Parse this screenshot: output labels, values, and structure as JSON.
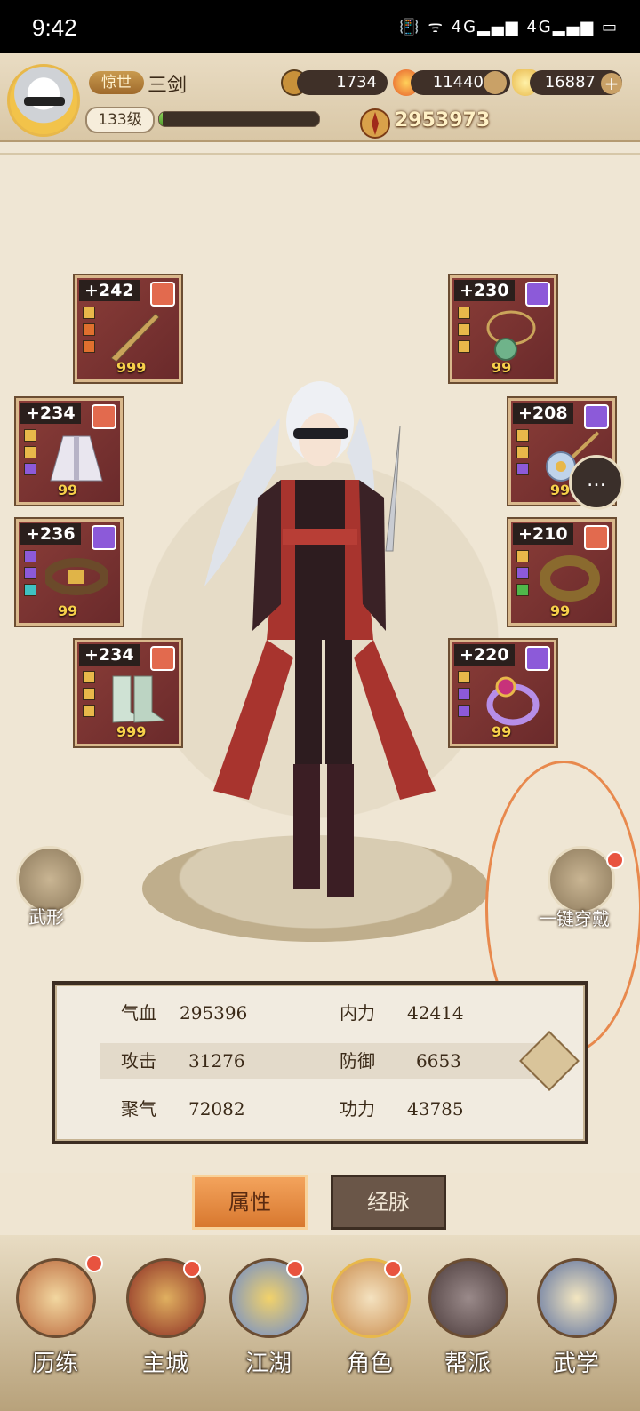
{
  "status_bar": {
    "time": "9:42",
    "icons": "📳 ᯤ 4G▂▄▆ 4G▂▄▆ ▭"
  },
  "player": {
    "tag": "惊世",
    "name": "三剑",
    "level": "133级",
    "xp_fraction": 0.02,
    "power": "2953973"
  },
  "currencies": [
    {
      "name": "copper-coin",
      "value": "1734",
      "color": "#c8913a"
    },
    {
      "name": "spirit-jade",
      "value": "11440",
      "color": "#e65a2a"
    },
    {
      "name": "gold-ingot",
      "value": "16887",
      "color": "#e8b84a"
    }
  ],
  "equipment_left": [
    {
      "slot": "weapon",
      "level": "+242",
      "count": "999",
      "quality_color": "#e26a4e",
      "gems": [
        "#e8b84a",
        "#e0702e",
        "#e0702e"
      ]
    },
    {
      "slot": "robe",
      "level": "+234",
      "count": "99",
      "quality_color": "#e26a4e",
      "gems": [
        "#e8b84a",
        "#e8b84a",
        "#8c5ad9"
      ]
    },
    {
      "slot": "belt",
      "level": "+236",
      "count": "99",
      "quality_color": "#8c5ad9",
      "gems": [
        "#8c5ad9",
        "#8c5ad9",
        "#3fc2c2"
      ]
    },
    {
      "slot": "boots",
      "level": "+234",
      "count": "999",
      "quality_color": "#e26a4e",
      "gems": [
        "#e8b84a",
        "#e8b84a",
        "#e8b84a"
      ]
    }
  ],
  "equipment_right": [
    {
      "slot": "necklace",
      "level": "+230",
      "count": "99",
      "quality_color": "#8c5ad9",
      "gems": [
        "#e8b84a",
        "#e8b84a",
        "#e8b84a"
      ]
    },
    {
      "slot": "hairpin",
      "level": "+208",
      "count": "99",
      "quality_color": "#8c5ad9",
      "gems": [
        "#e8b84a",
        "#e8b84a",
        "#8c5ad9"
      ]
    },
    {
      "slot": "bracer",
      "level": "+210",
      "count": "99",
      "quality_color": "#e26a4e",
      "gems": [
        "#e8b84a",
        "#8c5ad9",
        "#4fb84a"
      ]
    },
    {
      "slot": "ring",
      "level": "+220",
      "count": "99",
      "quality_color": "#8c5ad9",
      "gems": [
        "#e8b84a",
        "#8c5ad9",
        "#8c5ad9"
      ]
    }
  ],
  "side_buttons": {
    "left_label": "武形",
    "right_label": "一键穿戴"
  },
  "stats": [
    [
      {
        "k": "气血",
        "v": "295396"
      },
      {
        "k": "内力",
        "v": "42414"
      }
    ],
    [
      {
        "k": "攻击",
        "v": "31276"
      },
      {
        "k": "防御",
        "v": "6653"
      }
    ],
    [
      {
        "k": "聚气",
        "v": "72082"
      },
      {
        "k": "功力",
        "v": "43785"
      }
    ]
  ],
  "tabs": {
    "active": "属性",
    "inactive": "经脉"
  },
  "nav": [
    {
      "label": "历练",
      "badge": true
    },
    {
      "label": "主城",
      "badge": true
    },
    {
      "label": "江湖",
      "badge": true
    },
    {
      "label": "角色",
      "badge": true
    },
    {
      "label": "帮派",
      "badge": false
    },
    {
      "label": "武学",
      "badge": false
    }
  ]
}
